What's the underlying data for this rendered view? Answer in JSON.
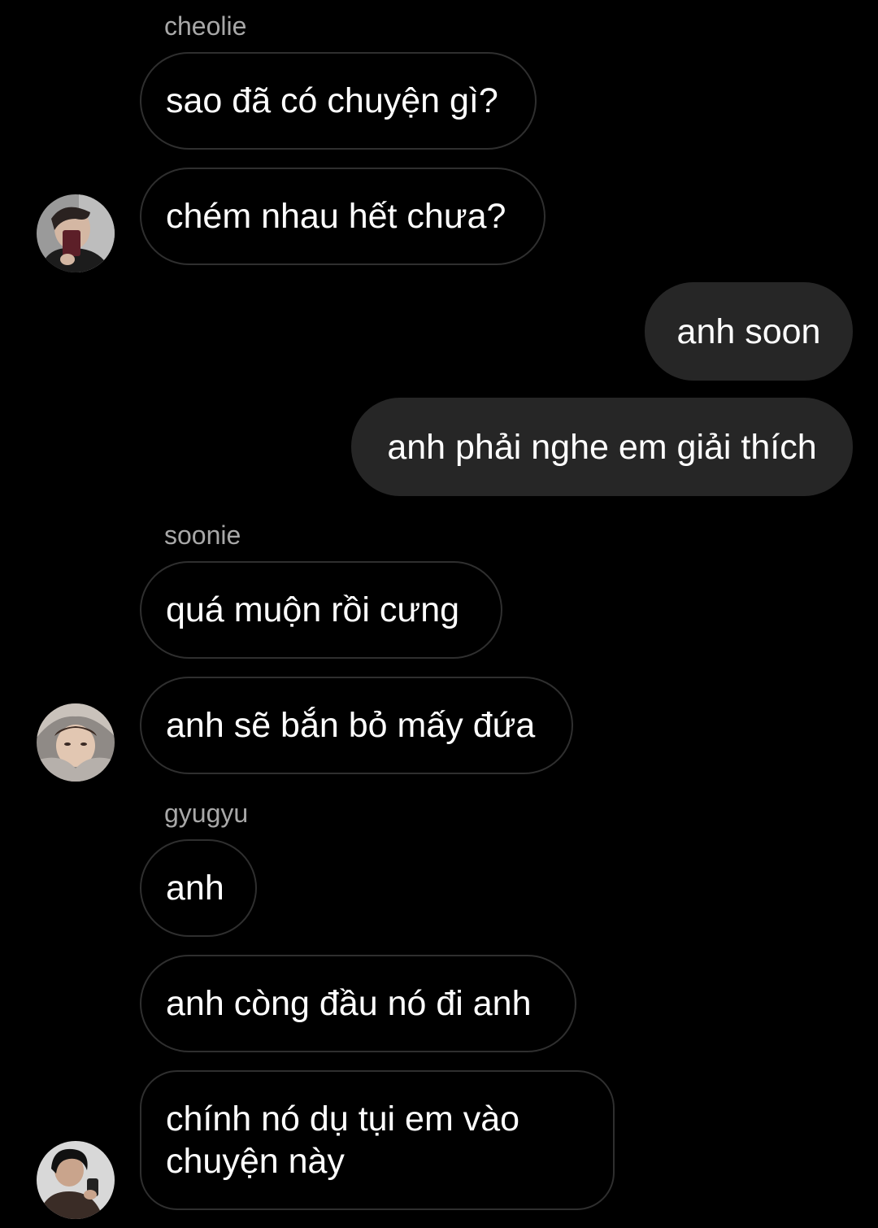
{
  "messages": [
    {
      "sender": "cheolie",
      "text": "sao đã có chuyện gì?"
    },
    {
      "text": "chém nhau hết chưa?"
    },
    {
      "text": "anh soon"
    },
    {
      "text": "anh phải nghe em giải thích"
    },
    {
      "sender": "soonie",
      "text": "quá muộn rồi cưng"
    },
    {
      "text": "anh sẽ bắn bỏ mấy đứa"
    },
    {
      "sender": "gyugyu",
      "text": "anh"
    },
    {
      "text": "anh còng đầu nó đi anh"
    },
    {
      "text_lines": [
        "chính nó dụ tụi em vào",
        "chuyện này"
      ]
    }
  ],
  "colors": {
    "background": "#000000",
    "outgoing_bubble": "#262626",
    "incoming_border": "#2f2f2f",
    "sender_name": "#a8a8a8",
    "text": "#ffffff"
  },
  "avatars": [
    "cheolie-avatar",
    "soonie-avatar",
    "gyugyu-avatar"
  ]
}
